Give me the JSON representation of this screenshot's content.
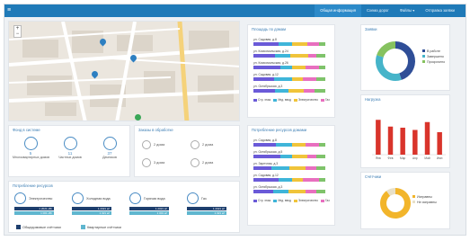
{
  "topbar": {
    "logo": "≡",
    "nav": [
      {
        "label": "Общая информация",
        "active": true
      },
      {
        "label": "Схема дорог",
        "active": false
      },
      {
        "label": "Файлы ▾",
        "active": false
      },
      {
        "label": "Отправка заявки",
        "active": false
      }
    ]
  },
  "map": {
    "zoom_in": "+",
    "zoom_out": "−"
  },
  "stats": {
    "title": "Фонд в системе",
    "items": [
      {
        "value": "5",
        "label": "Многоквартирных домов"
      },
      {
        "value": "11",
        "label": "Частных домов"
      },
      {
        "value": "37",
        "label": "Дачников"
      }
    ]
  },
  "counters": {
    "title": "Заказы в обработке",
    "items": [
      {
        "label": "2 дома"
      },
      {
        "label": "2 дома"
      },
      {
        "label": "3 дома"
      },
      {
        "label": "2 дома"
      }
    ]
  },
  "resources": {
    "title": "Потребление ресурсов",
    "items": [
      {
        "label": "Электричество",
        "dark": "1 2021 кВт",
        "light": "1 001 кВт"
      },
      {
        "label": "Холодная вода",
        "dark": "1 2021 м³",
        "light": "1 021 м³"
      },
      {
        "label": "Горячая вода",
        "dark": "1 2021 м³",
        "light": "1 001 м³"
      },
      {
        "label": "Газ",
        "dark": "1 2021 м³",
        "light": "1 021 м³"
      }
    ],
    "legend": [
      {
        "label": "Общедомовые счётчики",
        "color": "#1e3f6e"
      },
      {
        "label": "Квартирные счётчики",
        "color": "#5fb6cf"
      }
    ]
  },
  "houses_panel": {
    "title": "Площадь по домам",
    "rows": [
      {
        "label": "ул. Садовая, д.8",
        "segs": [
          22,
          12,
          14,
          10,
          6
        ]
      },
      {
        "label": "ул. Комсомольская, д.24",
        "segs": [
          20,
          14,
          16,
          8,
          8
        ]
      },
      {
        "label": "ул. Комсомольская, д.26",
        "segs": [
          24,
          10,
          12,
          12,
          6
        ]
      },
      {
        "label": "ул. Садовая, д.12",
        "segs": [
          18,
          16,
          10,
          12,
          8
        ]
      },
      {
        "label": "ул. Октябрьская, д.3",
        "segs": [
          20,
          12,
          14,
          10,
          10
        ]
      }
    ],
    "legend": [
      "Стр. этаж",
      "Инд. ввод",
      "Электричество",
      "Газ"
    ]
  },
  "utility_panel": {
    "title": "Потребление ресурсов домами",
    "rows": [
      {
        "label": "ул. Садовая, д.8",
        "segs": [
          20,
          14,
          12,
          12,
          6
        ]
      },
      {
        "label": "ул. Октябрьская, д.5",
        "segs": [
          24,
          10,
          14,
          8,
          8
        ]
      },
      {
        "label": "ул. Заречная, д.3",
        "segs": [
          16,
          16,
          14,
          10,
          8
        ]
      },
      {
        "label": "ул. Садовая, д.12",
        "segs": [
          22,
          12,
          10,
          14,
          6
        ]
      },
      {
        "label": "ул. Октябрьская, д.3",
        "segs": [
          18,
          14,
          16,
          10,
          8
        ]
      }
    ],
    "legend": [
      "Стр. этаж",
      "Инд. ввод",
      "Электричество",
      "Газ"
    ]
  },
  "colors": {
    "seg": [
      "#6a5ad8",
      "#3fb5d9",
      "#f0c43a",
      "#e86fbf",
      "#7fc36b"
    ]
  },
  "chart_data": [
    {
      "type": "pie",
      "title": "Заявки",
      "categories": [
        "В работе",
        "Завершено",
        "Просрочено"
      ],
      "values": [
        45,
        35,
        20
      ],
      "colors": [
        "#2f4e97",
        "#46b4c9",
        "#86c25f"
      ],
      "legend_position": "right"
    },
    {
      "type": "bar",
      "title": "Нагрузка",
      "categories": [
        "Янв",
        "Фев",
        "Мар",
        "Апр",
        "Май",
        "Июн"
      ],
      "values": [
        62,
        50,
        48,
        44,
        58,
        40
      ],
      "ylim": [
        0,
        80
      ],
      "color": "#d9342b"
    },
    {
      "type": "pie",
      "title": "Счётчики",
      "categories": [
        "Исправны",
        "Не исправны"
      ],
      "values": [
        90,
        10
      ],
      "colors": [
        "#f2b52b",
        "#e8e0c8"
      ],
      "legend_position": "bottom"
    }
  ]
}
